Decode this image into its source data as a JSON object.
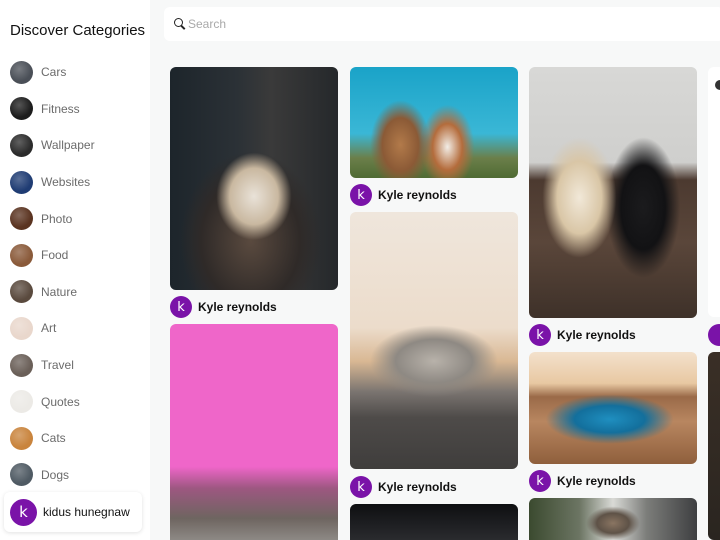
{
  "sidebar": {
    "title": "Discover Categories",
    "categories": [
      {
        "label": "Cars",
        "thumb_color": "#4a4f57"
      },
      {
        "label": "Fitness",
        "thumb_color": "#1c1c1c"
      },
      {
        "label": "Wallpaper",
        "thumb_color": "#2b2b2b"
      },
      {
        "label": "Websites",
        "thumb_color": "#1f3c73"
      },
      {
        "label": "Photo",
        "thumb_color": "#5a3320"
      },
      {
        "label": "Food",
        "thumb_color": "#8a5a3a"
      },
      {
        "label": "Nature",
        "thumb_color": "#5a4a3e"
      },
      {
        "label": "Art",
        "thumb_color": "#e9d7cc"
      },
      {
        "label": "Travel",
        "thumb_color": "#6a5f58"
      },
      {
        "label": "Quotes",
        "thumb_color": "#eceae6"
      },
      {
        "label": "Cats",
        "thumb_color": "#c9843d"
      },
      {
        "label": "Dogs",
        "thumb_color": "#4f5a63"
      }
    ],
    "user": {
      "initial": "k",
      "name": "kidus hunegnaw"
    }
  },
  "search": {
    "placeholder": "Search",
    "value": ""
  },
  "accent": "#7a13a8",
  "pins": [
    {
      "id": "husky",
      "description": "Husky dog portrait",
      "author": {
        "initial": "k",
        "name": "Kyle reynolds"
      }
    },
    {
      "id": "pink-wall-dogs",
      "description": "Dogs sitting in front of pink wall",
      "author": null
    },
    {
      "id": "dogs-sky",
      "description": "Two dogs looking up at blue sky",
      "author": {
        "initial": "k",
        "name": "Kyle reynolds"
      }
    },
    {
      "id": "challenger",
      "description": "Grey muscle car front view",
      "author": {
        "initial": "k",
        "name": "Kyle reynolds"
      }
    },
    {
      "id": "dark-cars",
      "description": "Cars in dark garage",
      "author": null
    },
    {
      "id": "dogs-rug",
      "description": "White and black dog on a rug",
      "author": {
        "initial": "k",
        "name": "Kyle reynolds"
      }
    },
    {
      "id": "camaro",
      "description": "Blue sports car in desert",
      "author": {
        "initial": "k",
        "name": "Kyle reynolds"
      }
    },
    {
      "id": "robot-street",
      "description": "Robot in a street",
      "author": null
    }
  ]
}
